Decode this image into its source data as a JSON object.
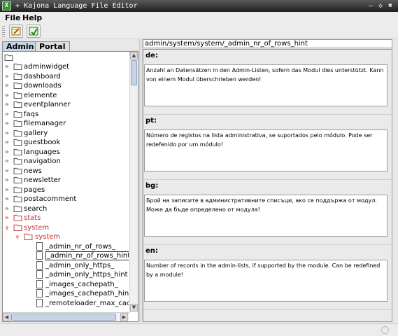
{
  "window": {
    "title": "+ Kajona Language File Editor",
    "app_icon": "X",
    "controls": [
      "–",
      "◇",
      "✖"
    ]
  },
  "menubar": {
    "file_label": "File",
    "help_label": "Help"
  },
  "toolbar": {
    "buttons": [
      {
        "icon": "edit-icon"
      },
      {
        "icon": "export-icon"
      }
    ]
  },
  "left_panel": {
    "tabs": [
      {
        "label": "Admin",
        "active": true
      },
      {
        "label": "Portal",
        "active": false
      }
    ],
    "tree": {
      "modules": [
        {
          "label": "adminwidget"
        },
        {
          "label": "dashboard"
        },
        {
          "label": "downloads"
        },
        {
          "label": "elemente"
        },
        {
          "label": "eventplanner"
        },
        {
          "label": "faqs"
        },
        {
          "label": "filemanager"
        },
        {
          "label": "gallery"
        },
        {
          "label": "guestbook"
        },
        {
          "label": "languages"
        },
        {
          "label": "navigation"
        },
        {
          "label": "news"
        },
        {
          "label": "newsletter"
        },
        {
          "label": "pages"
        },
        {
          "label": "postacomment"
        },
        {
          "label": "search"
        },
        {
          "label": "stats"
        },
        {
          "label": "system"
        }
      ],
      "subfolder": "system",
      "entries": [
        {
          "label": "_admin_nr_of_rows_"
        },
        {
          "label": "_admin_nr_of_rows_hint"
        },
        {
          "label": "_admin_only_https_"
        },
        {
          "label": "_admin_only_https_hint"
        },
        {
          "label": "_images_cachepath_"
        },
        {
          "label": "_images_cachepath_hint"
        },
        {
          "label": "_remoteloader_max_cachet"
        }
      ]
    }
  },
  "right_panel": {
    "key_path": "admin/system/system/_admin_nr_of_rows_hint",
    "languages": [
      {
        "code": "de:",
        "text": "Anzahl an Datensätzen in den Admin-Listen, sofern das Modul dies unterstützt. Kann von einem Modul überschrieben werden!"
      },
      {
        "code": "pt:",
        "text": "Número de registos na lista administrativa, se suportados pelo módulo. Pode ser redefenido por um módulo!"
      },
      {
        "code": "bg:",
        "text": "Брой на записите в административните списъци, ако се поддържа от модул. Може да бъде определено от модула!"
      },
      {
        "code": "en:",
        "text": "Number of records in the admin-lists, if supported by the module. Can be redefined by a module!"
      }
    ]
  },
  "colors": {
    "accent": "#c43030",
    "selection_frame": "#333333",
    "tab_active": "#c8d5e8"
  }
}
